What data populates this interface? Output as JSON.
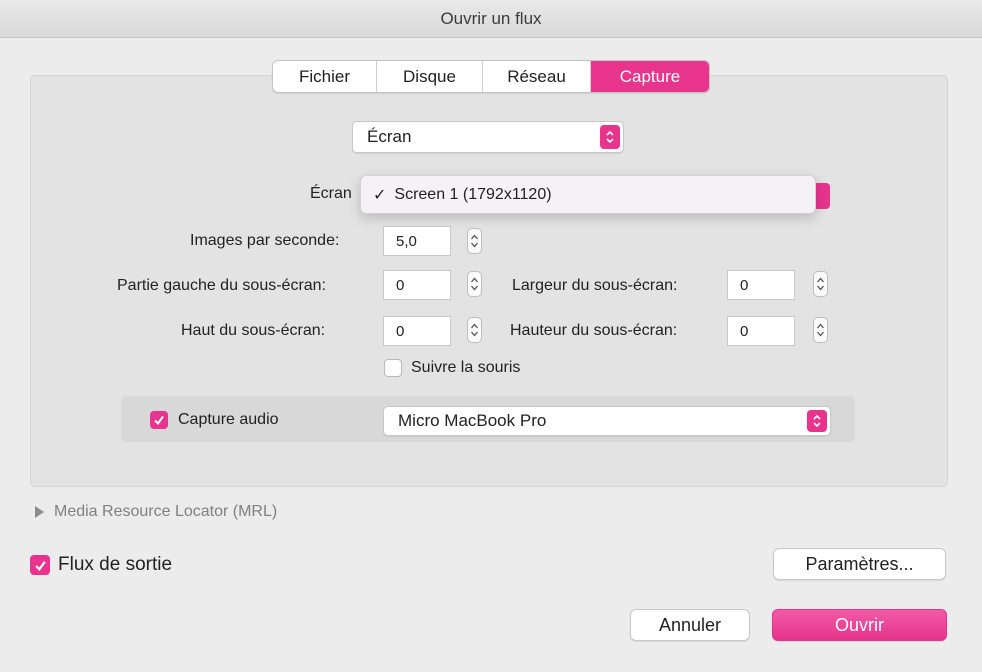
{
  "window": {
    "title": "Ouvrir un flux"
  },
  "tabs": [
    {
      "label": "Fichier",
      "active": false
    },
    {
      "label": "Disque",
      "active": false
    },
    {
      "label": "Réseau",
      "active": false
    },
    {
      "label": "Capture",
      "active": true
    }
  ],
  "source_popup": {
    "value": "Écran"
  },
  "screen_row": {
    "label": "Écran",
    "menu_item": "Screen 1 (1792x1120)",
    "checkmark": "✓"
  },
  "fps": {
    "label": "Images par seconde:",
    "value": "5,0"
  },
  "subscreen": {
    "left_label": "Partie gauche du sous-écran:",
    "left_value": "0",
    "width_label": "Largeur du sous-écran:",
    "width_value": "0",
    "top_label": "Haut du sous-écran:",
    "top_value": "0",
    "height_label": "Hauteur du sous-écran:",
    "height_value": "0"
  },
  "follow_mouse": {
    "label": "Suivre la souris",
    "checked": false
  },
  "audio": {
    "label": "Capture audio",
    "checked": true,
    "device": "Micro MacBook Pro"
  },
  "mrl": {
    "label": "Media Resource Locator (MRL)"
  },
  "output": {
    "label": "Flux de sortie",
    "checked": true,
    "settings_button": "Paramètres..."
  },
  "buttons": {
    "cancel": "Annuler",
    "open": "Ouvrir"
  },
  "colors": {
    "accent": "#e9348e",
    "window_bg": "#ececec",
    "panel_bg": "#e3e3e3"
  }
}
